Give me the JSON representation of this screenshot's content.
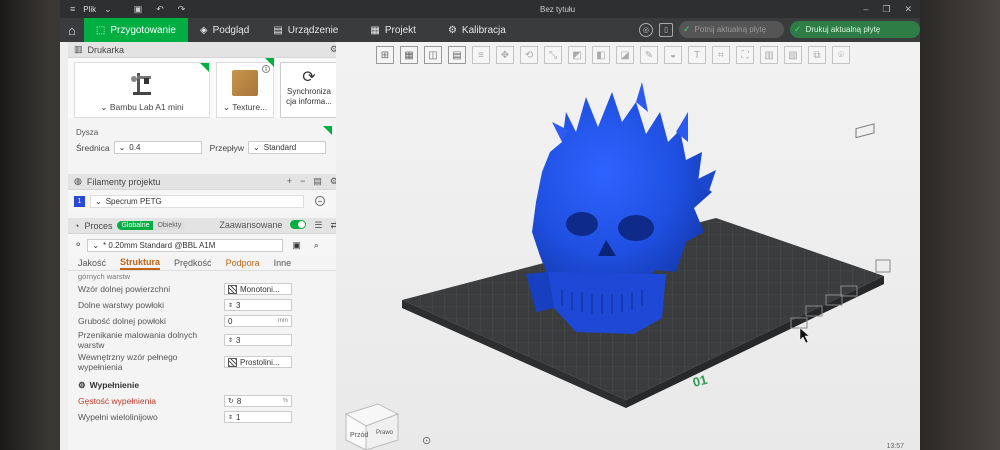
{
  "titlebar": {
    "app_menu": "Plik",
    "title": "Bez tytułu"
  },
  "tabs": [
    {
      "label": "Przygotowanie",
      "active": true
    },
    {
      "label": "Podgląd"
    },
    {
      "label": "Urządzenie"
    },
    {
      "label": "Projekt"
    },
    {
      "label": "Kalibracja"
    }
  ],
  "actions": {
    "slice_label": "Potnij aktualną płytę",
    "print_label": "Drukuj aktualną płytę"
  },
  "printer_section": {
    "title": "Drukarka",
    "printer_name": "Bambu Lab A1 mini",
    "plate_label": "Texture...",
    "sync_label": "Synchroniza cja informa..."
  },
  "nozzle": {
    "title": "Dysza",
    "diameter_label": "Średnica",
    "diameter_value": "0.4",
    "flow_label": "Przepływ",
    "flow_value": "Standard"
  },
  "filaments": {
    "title": "Filamenty projektu",
    "items": [
      {
        "index": "1",
        "name": "Specrum PETG",
        "color": "#2848d6"
      }
    ]
  },
  "process": {
    "title": "Proces",
    "scope_on": "Globalne",
    "scope_off": "Obiekty",
    "advanced_label": "Zaawansowane",
    "preset": "* 0.20mm Standard @BBL A1M",
    "tabs": [
      "Jakość",
      "Struktura",
      "Prędkość",
      "Podpora",
      "Inne"
    ],
    "partial_label": "górnych warstw",
    "rows": [
      {
        "label": "Wzór dolnej powierzchni",
        "value": "Monotoni..."
      },
      {
        "label": "Dolne warstwy powłoki",
        "value": "3"
      },
      {
        "label": "Grubość dolnej powłoki",
        "value": "0",
        "unit": "mm"
      },
      {
        "label": "Przenikanie malowania dolnych warstw",
        "value": "3"
      },
      {
        "label": "Wewnętrzny wzór pełnego wypełnienia",
        "value": "Prostolini..."
      }
    ],
    "infill_title": "Wypełnienie",
    "infill_rows": [
      {
        "label": "Gęstość wypełnienia",
        "value": "8",
        "unit": "%"
      },
      {
        "label": "Wypełni wielolinijowo",
        "value": "1"
      }
    ]
  },
  "viewport": {
    "plate_number": "01",
    "view_cube_front": "Przód",
    "view_cube_right": "Prawo"
  },
  "clock": "13:57",
  "colors": {
    "accent": "#00ae42",
    "model": "#1f4fe0",
    "plate": "#3a3c3e"
  }
}
